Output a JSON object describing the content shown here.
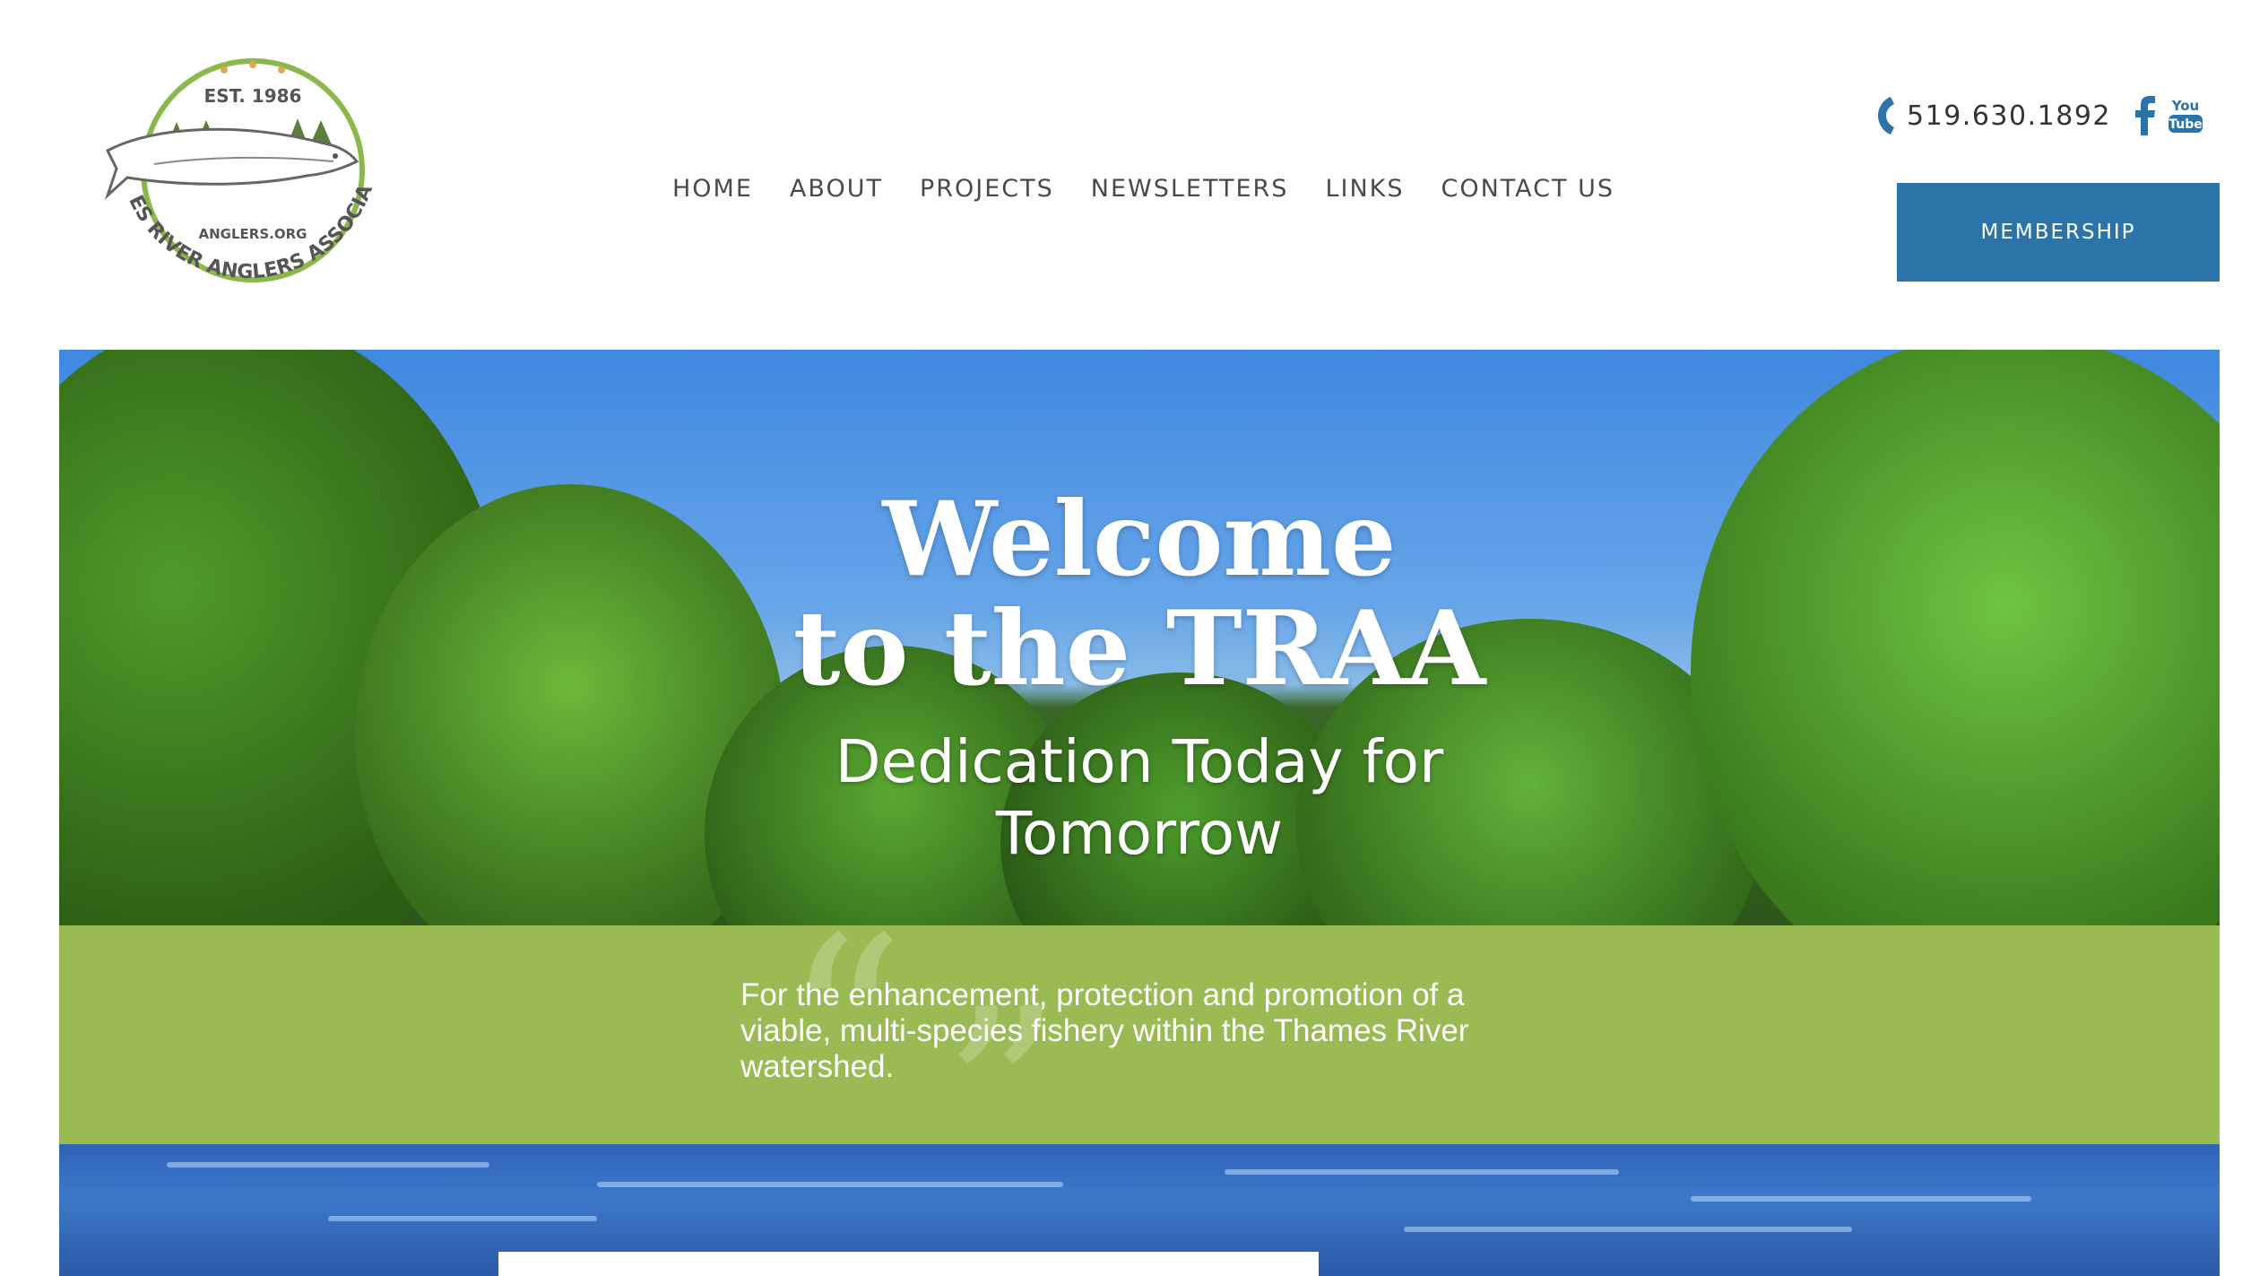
{
  "logo": {
    "est": "EST. 1986",
    "site": "ANGLERS.ORG",
    "org_name": "THAMES RIVER ANGLERS ASSOCIATION"
  },
  "nav": [
    {
      "label": "HOME"
    },
    {
      "label": "ABOUT"
    },
    {
      "label": "PROJECTS"
    },
    {
      "label": "NEWSLETTERS"
    },
    {
      "label": "LINKS"
    },
    {
      "label": "CONTACT US"
    }
  ],
  "contact": {
    "phone": "519.630.1892",
    "icons": [
      "phone-icon",
      "facebook-icon",
      "youtube-icon"
    ],
    "youtube_text_top": "You",
    "youtube_text_bottom": "Tube"
  },
  "membership_label": "MEMBERSHIP",
  "hero": {
    "title_line1": "Welcome",
    "title_line2": "to the TRAA",
    "subtitle_line1": "Dedication Today for",
    "subtitle_line2": "Tomorrow"
  },
  "mission": {
    "text": "For the enhancement, protection and promotion of a viable, multi-species fishery within the Thames River watershed."
  },
  "colors": {
    "brand_blue": "#2a74a9",
    "band_green": "#9aba54",
    "logo_green": "#8ab84a",
    "tree_green": "#5c7f3a"
  }
}
